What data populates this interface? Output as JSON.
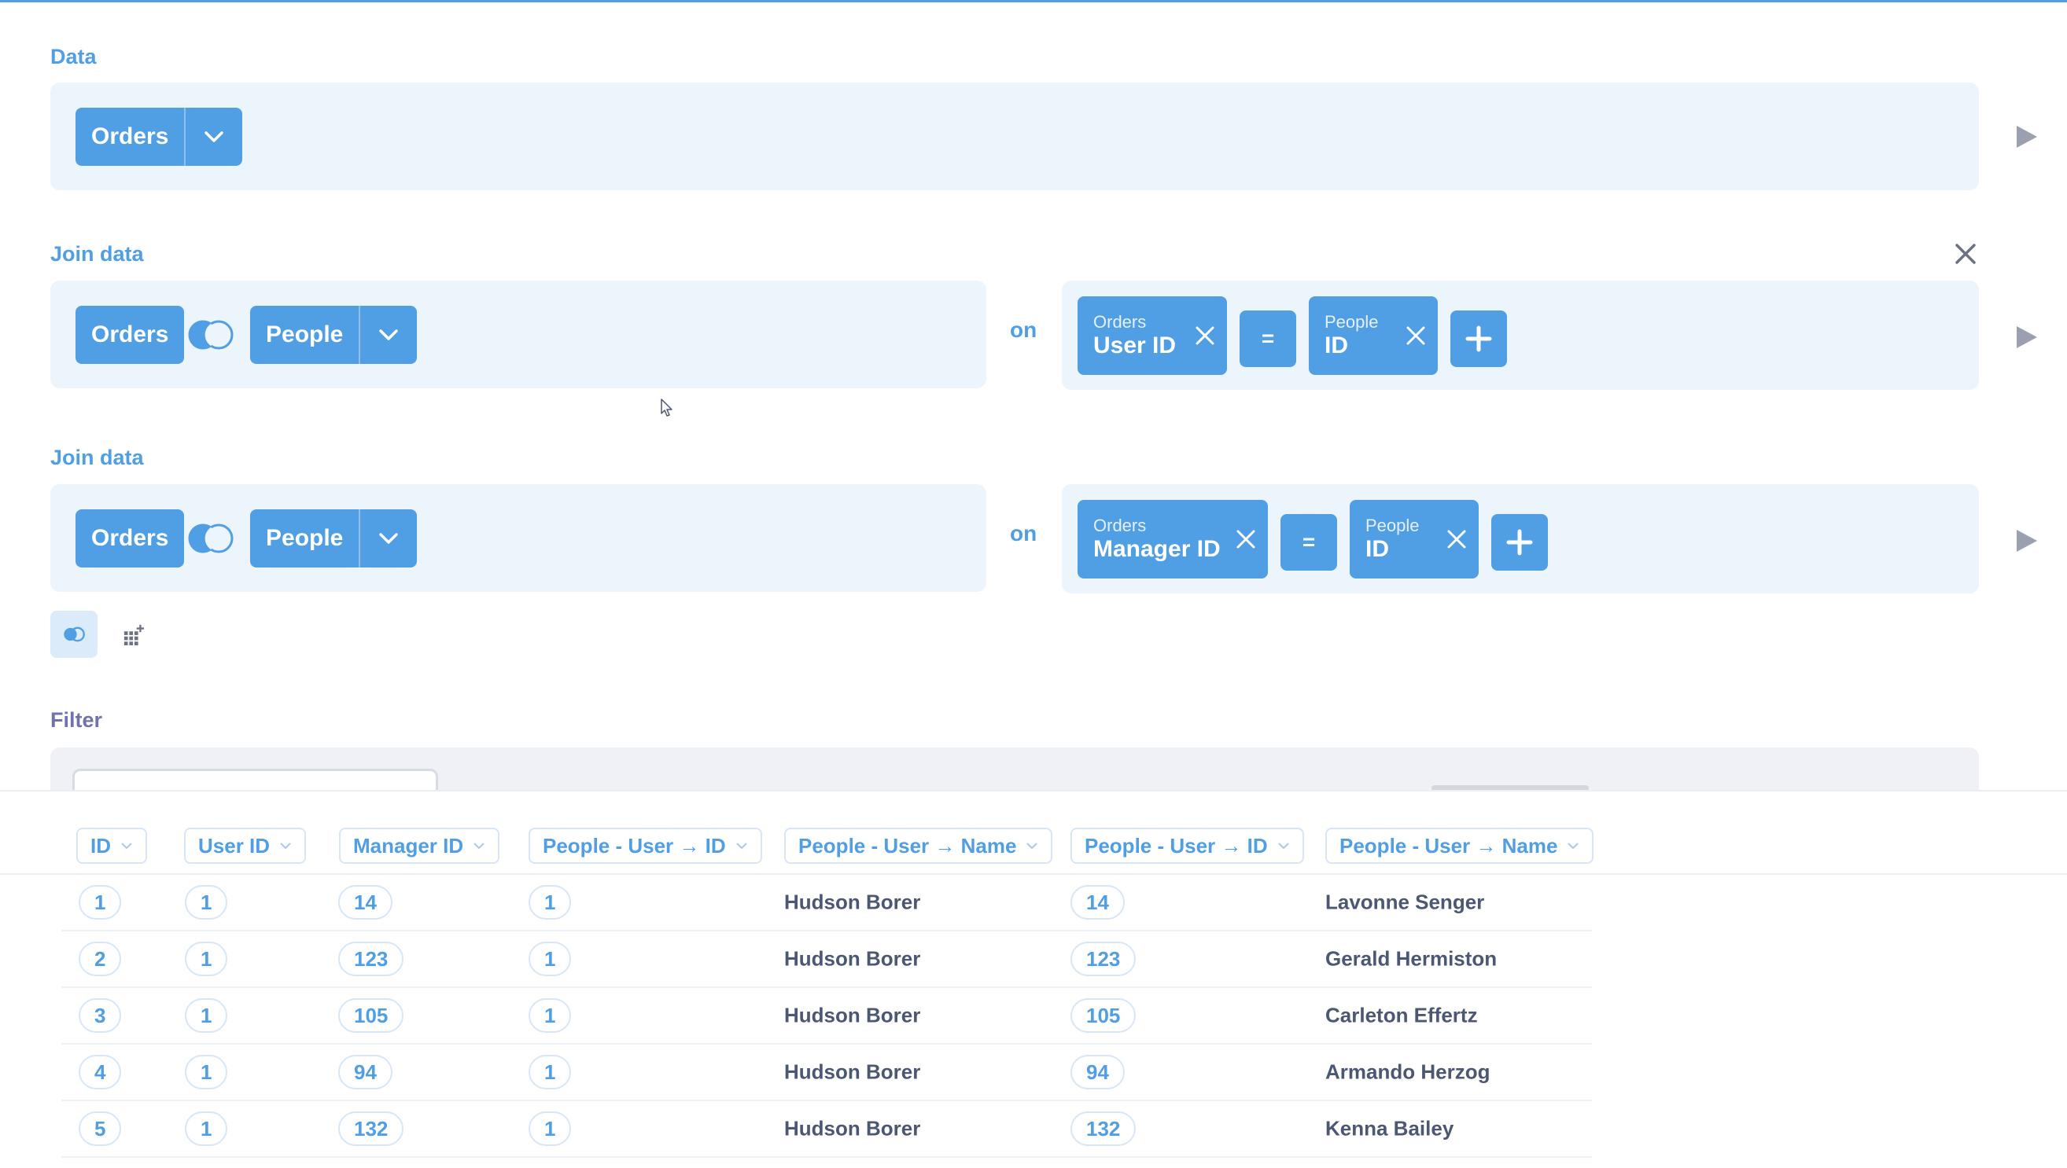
{
  "data_section": {
    "label": "Data",
    "source_table": "Orders"
  },
  "joins": [
    {
      "label": "Join data",
      "left_table": "Orders",
      "right_table": "People",
      "on_label": "on",
      "left_field": {
        "table": "Orders",
        "column": "User ID"
      },
      "operator": "=",
      "right_field": {
        "table": "People",
        "column": "ID"
      }
    },
    {
      "label": "Join data",
      "left_table": "Orders",
      "right_table": "People",
      "on_label": "on",
      "left_field": {
        "table": "Orders",
        "column": "Manager ID"
      },
      "operator": "=",
      "right_field": {
        "table": "People",
        "column": "ID"
      }
    }
  ],
  "filter_section": {
    "label": "Filter"
  },
  "table": {
    "columns": [
      "ID",
      "User ID",
      "Manager ID",
      "People - User → ID",
      "People - User → Name",
      "People - User → ID",
      "People - User → Name"
    ],
    "rows": [
      [
        "1",
        "1",
        "14",
        "1",
        "Hudson Borer",
        "14",
        "Lavonne Senger"
      ],
      [
        "2",
        "1",
        "123",
        "1",
        "Hudson Borer",
        "123",
        "Gerald Hermiston"
      ],
      [
        "3",
        "1",
        "105",
        "1",
        "Hudson Borer",
        "105",
        "Carleton Effertz"
      ],
      [
        "4",
        "1",
        "94",
        "1",
        "Hudson Borer",
        "94",
        "Armando Herzog"
      ],
      [
        "5",
        "1",
        "132",
        "1",
        "Hudson Borer",
        "132",
        "Kenna Bailey"
      ]
    ]
  },
  "icons": {
    "run": "play-icon",
    "close": "close-icon",
    "join": "join-venn-icon",
    "expand": "chevron-down-icon",
    "add": "plus-icon",
    "remove": "x-icon",
    "custom_column": "grid-plus-icon"
  },
  "colors": {
    "accent": "#509ee3",
    "panel_bg": "#ecf4fc",
    "filter_accent": "#7172ad",
    "filter_bg": "#f0f0f7",
    "text": "#4c5773"
  }
}
